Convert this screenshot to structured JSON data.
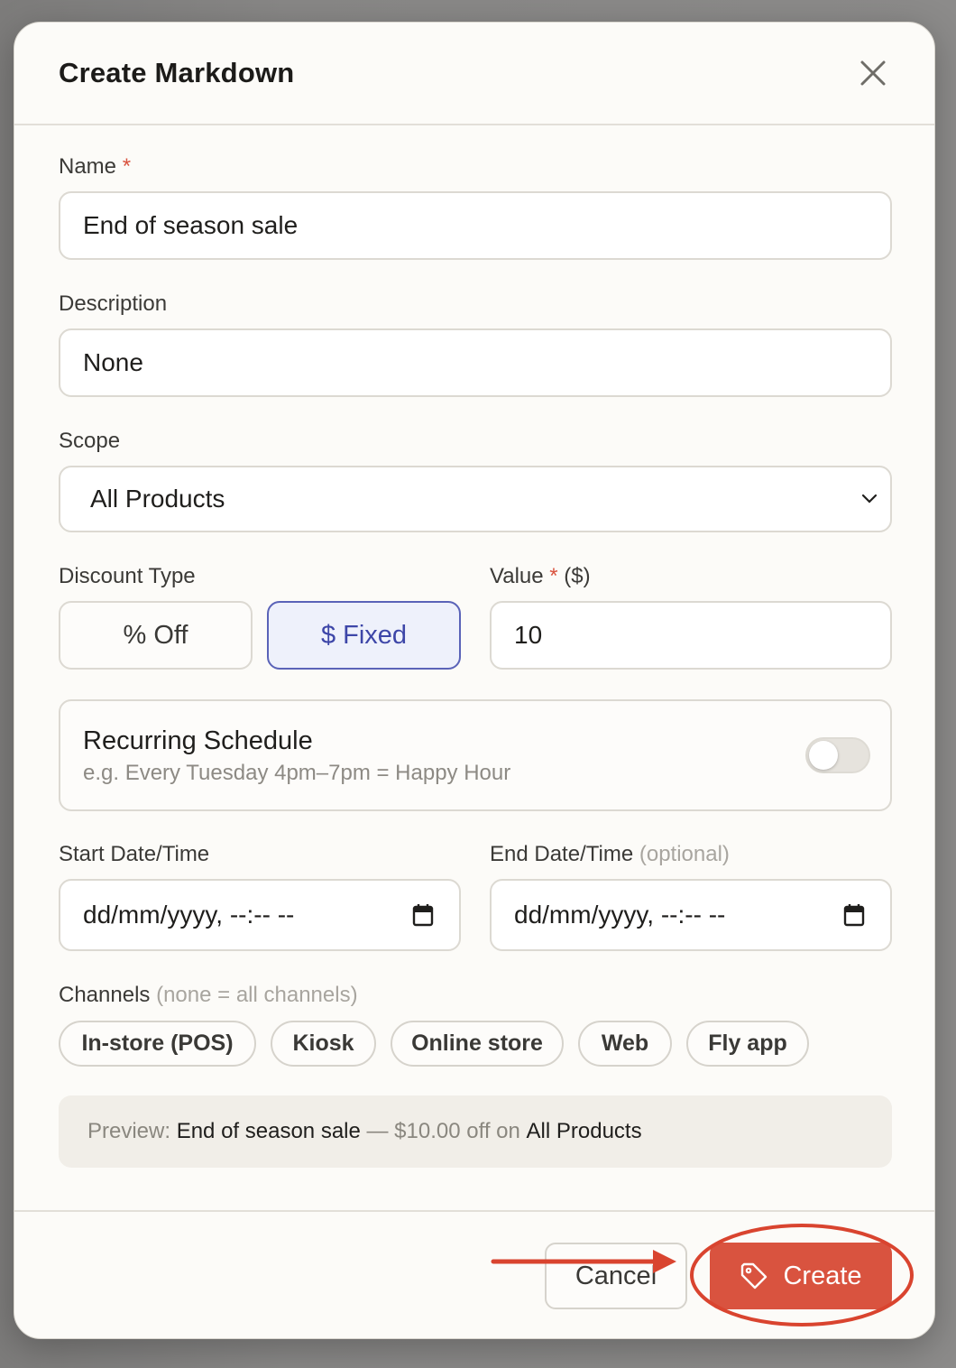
{
  "dialog": {
    "title": "Create Markdown"
  },
  "form": {
    "name_label": "Name",
    "required_mark": "*",
    "name_value": "End of season sale",
    "description_label": "Description",
    "description_value": "None",
    "scope_label": "Scope",
    "scope_selected": "All Products",
    "discount_type_label": "Discount Type",
    "discount_options": [
      "% Off",
      "$ Fixed"
    ],
    "discount_selected": "$ Fixed",
    "value_label": "Value",
    "value_unit": "($)",
    "value_value": "10",
    "recurring_title": "Recurring Schedule",
    "recurring_subtitle": "e.g. Every Tuesday 4pm–7pm = Happy Hour",
    "recurring_enabled": false,
    "start_label": "Start Date/Time",
    "start_placeholder": "dd/mm/yyyy, --:-- --",
    "end_label": "End Date/Time",
    "end_optional": "(optional)",
    "end_placeholder": "dd/mm/yyyy, --:-- --",
    "channels_label": "Channels",
    "channels_hint": "(none = all channels)",
    "channels": [
      "In-store (POS)",
      "Kiosk",
      "Online store",
      "Web",
      "Fly app"
    ]
  },
  "preview": {
    "prefix": "Preview:",
    "name": "End of season sale",
    "middle": "— $10.00 off on",
    "scope": "All Products"
  },
  "footer": {
    "cancel_label": "Cancel",
    "create_label": "Create"
  },
  "colors": {
    "accent": "#d9533f",
    "selected_border": "#5a63b8",
    "selected_bg": "#eef1fb"
  },
  "icons": [
    "close-icon",
    "chevron-down-icon",
    "calendar-icon",
    "tag-icon"
  ]
}
